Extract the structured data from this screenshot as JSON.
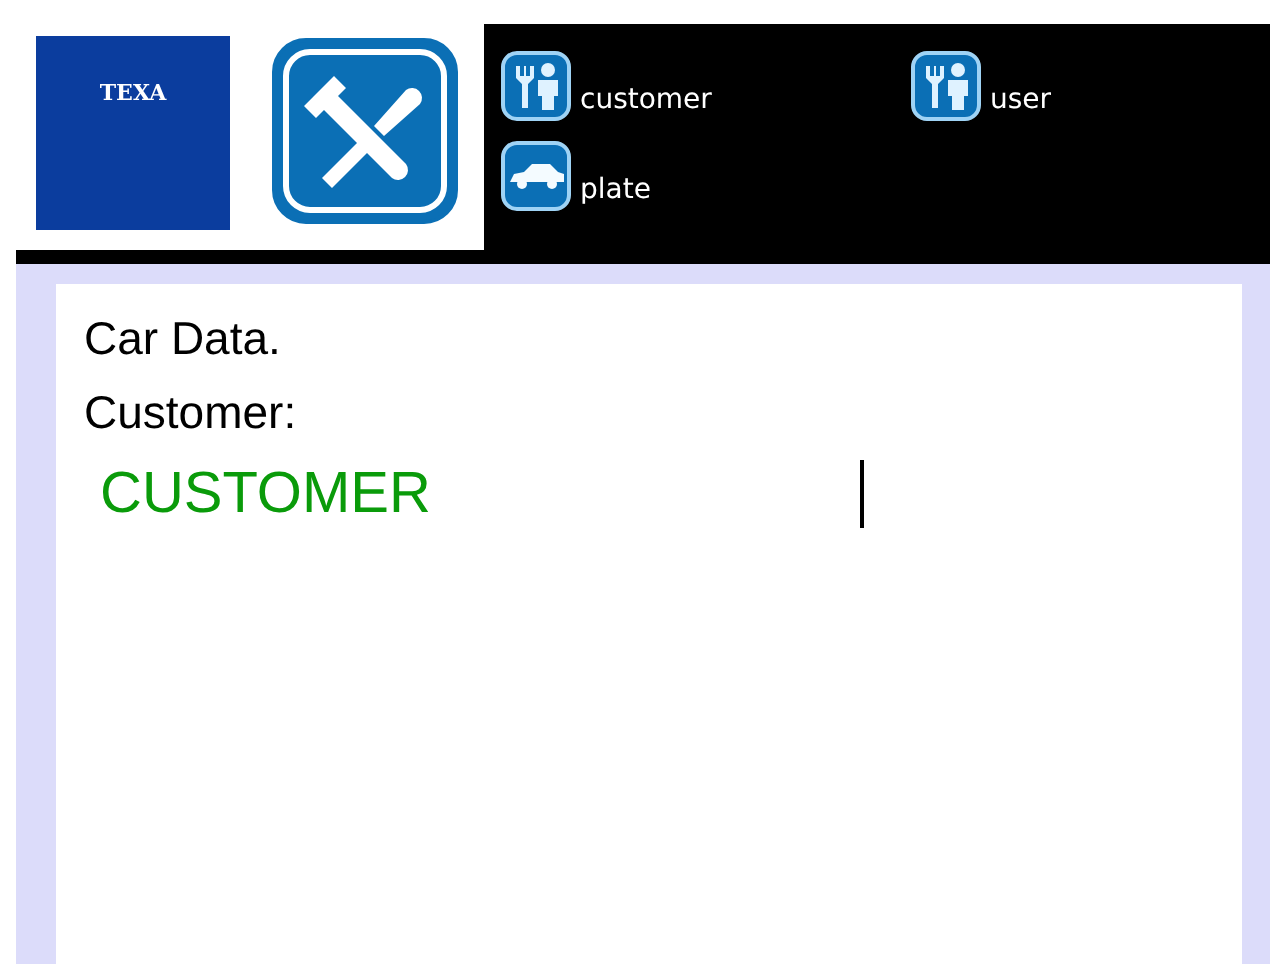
{
  "logo": {
    "text": "TEXA"
  },
  "shortcuts": [
    {
      "label": "customer",
      "kind": "person"
    },
    {
      "label": "user",
      "kind": "person"
    },
    {
      "label": "plate",
      "kind": "car"
    }
  ],
  "panel": {
    "title": "Car Data.",
    "field_label": "Customer:",
    "field_value": "CUSTOMER"
  }
}
